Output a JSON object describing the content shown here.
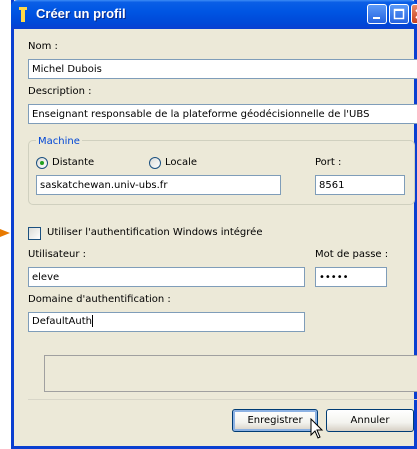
{
  "window": {
    "title": "Créer un profil"
  },
  "form": {
    "nom_label": "Nom :",
    "nom_value": "Michel Dubois",
    "description_label": "Description :",
    "description_value": "Enseignant responsable de la plateforme géodécisionnelle de l'UBS",
    "machine": {
      "group_label": "Machine",
      "option_distante": "Distante",
      "option_locale": "Locale",
      "selected": "Distante",
      "host_value": "saskatchewan.univ-ubs.fr",
      "port_label": "Port :",
      "port_value": "8561"
    },
    "windows_auth_label": "Utiliser l'authentification Windows intégrée",
    "windows_auth_checked": false,
    "user_label": "Utilisateur :",
    "user_value": "eleve",
    "password_label": "Mot de passe :",
    "password_value": "•••••",
    "domain_label": "Domaine d'authentification :",
    "domain_value": "DefaultAuth"
  },
  "buttons": {
    "save": "Enregistrer",
    "cancel": "Annuler"
  },
  "colors": {
    "titlebar": "#0055e3",
    "window_bg": "#ece9d8",
    "group_label": "#0046d5",
    "pointer_arrow": "#e87a00"
  }
}
